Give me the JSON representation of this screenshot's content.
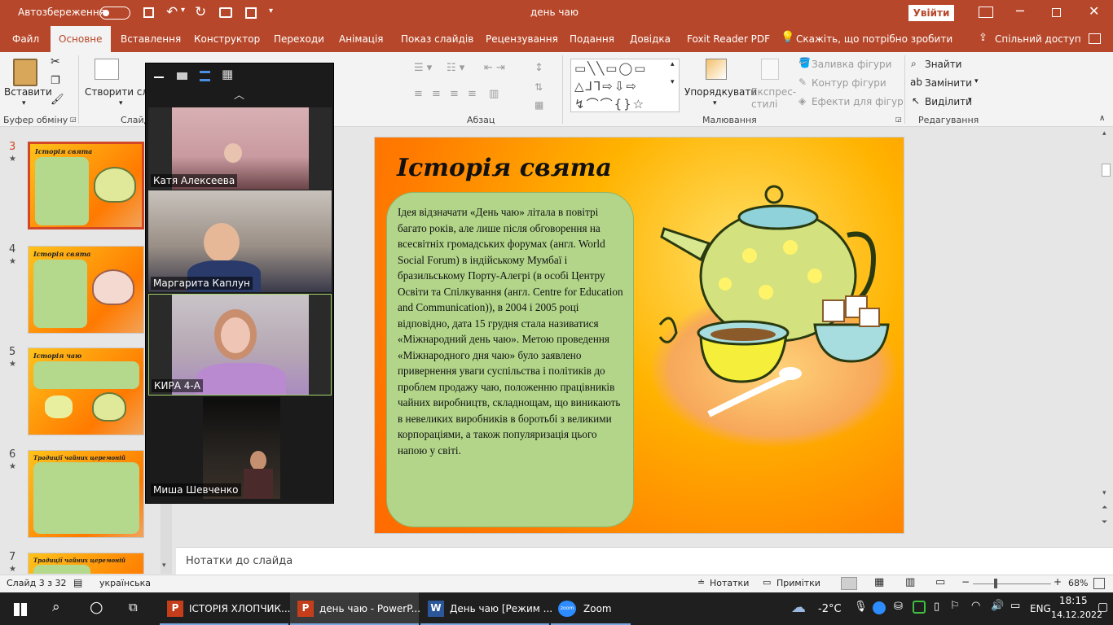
{
  "titlebar": {
    "autosave_label": "Автозбереження",
    "autosave_state": "Вимк.",
    "doc_title": "день чаю",
    "signin_label": "Увійти"
  },
  "tabs": [
    "Файл",
    "Основне",
    "Вставлення",
    "Конструктор",
    "Переходи",
    "Анімація",
    "Показ слайдів",
    "Рецензування",
    "Подання",
    "Довідка",
    "Foxit Reader PDF"
  ],
  "tell_me": "Скажіть, що потрібно зробити",
  "share_label": "Спільний доступ",
  "ribbon": {
    "paste_label": "Вставити",
    "clipboard_group": "Буфер обміну",
    "new_slide_label": "Створити слайд",
    "slides_group_short": "Слайд",
    "paragraph_group": "Абзац",
    "arrange_label": "Упорядкувати",
    "quick_styles_label": "Експрес-стилі",
    "shape_fill_label": "Заливка фігури",
    "shape_outline_label": "Контур фігури",
    "shape_effects_label": "Ефекти для фігур",
    "drawing_group": "Малювання",
    "find_label": "Знайти",
    "replace_label": "Замінити",
    "select_label": "Виділити",
    "editing_group": "Редагування"
  },
  "thumbnails": [
    {
      "num": "3",
      "title": "Історія свята",
      "selected": true
    },
    {
      "num": "4",
      "title": "Історія свята",
      "selected": false
    },
    {
      "num": "5",
      "title": "Історія чаю",
      "selected": false
    },
    {
      "num": "6",
      "title": "Традиції чайних церемоній",
      "selected": false
    },
    {
      "num": "7",
      "title": "Традиції чайних церемоній",
      "selected": false
    }
  ],
  "slide": {
    "title": "Історія свята",
    "body": "Ідея відзначати «День чаю» літала в повітрі багато років, але лише після обговорення на всесвітніх громадських форумах (англ. World Social Forum) в індійському Мумбаї і бразильському Порту-Алегрі (в особі Центру Освіти та Спілкування (англ. Centre for Education and Communication)), в 2004 і 2005 році відповідно, дата 15 грудня стала називатися «Міжнародний день чаю». Метою проведення «Міжнародного дня чаю» було заявлено привернення уваги суспільства і політиків до проблем продажу чаю, положенню працівників чайних виробництв, складнощам, що виникають в невеликих виробників в боротьбі з великими корпораціями, а також популяризація цього напою у світі."
  },
  "notes_placeholder": "Нотатки до слайда",
  "status": {
    "slide_counter": "Слайд 3 з 32",
    "language": "українська",
    "notes_btn": "Нотатки",
    "comments_btn": "Примітки",
    "zoom_level": "68%"
  },
  "zoom_window": {
    "participants": [
      {
        "name": "Катя Алексеева"
      },
      {
        "name": "Маргарита Каплун"
      },
      {
        "name": "КИРА 4-А"
      },
      {
        "name": "Миша Шевченко"
      }
    ]
  },
  "taskbar": {
    "items": [
      {
        "label": "ІСТОРІЯ ХЛОПЧИК..."
      },
      {
        "label": "день чаю - PowerP..."
      },
      {
        "label": "День чаю [Режим ..."
      },
      {
        "label": "Zoom"
      }
    ],
    "weather": "-2°C",
    "lang": "ENG",
    "time": "18:15",
    "date": "14.12.2022"
  },
  "colors": {
    "ppt_accent": "#b7472a",
    "selection": "#d24726",
    "bubble_green": "#b2d58a"
  }
}
